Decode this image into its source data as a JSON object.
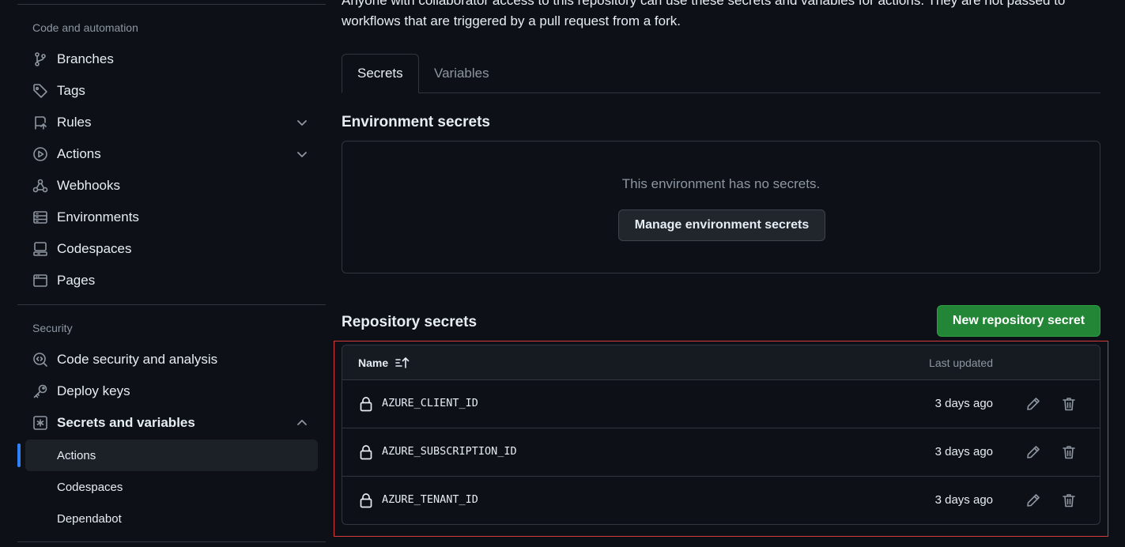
{
  "intro_text": "Anyone with collaborator access to this repository can use these secrets and variables for actions. They are not passed to workflows that are triggered by a pull request from a fork.",
  "sidebar": {
    "code_heading": "Code and automation",
    "code_items": [
      {
        "label": "Branches",
        "icon": "branch-icon"
      },
      {
        "label": "Tags",
        "icon": "tag-icon"
      },
      {
        "label": "Rules",
        "icon": "rules-icon",
        "expandable": true
      },
      {
        "label": "Actions",
        "icon": "play-icon",
        "expandable": true
      },
      {
        "label": "Webhooks",
        "icon": "webhook-icon"
      },
      {
        "label": "Environments",
        "icon": "server-icon"
      },
      {
        "label": "Codespaces",
        "icon": "codespaces-icon"
      },
      {
        "label": "Pages",
        "icon": "browser-icon"
      }
    ],
    "security_heading": "Security",
    "security_items": [
      {
        "label": "Code security and analysis",
        "icon": "codescan-icon"
      },
      {
        "label": "Deploy keys",
        "icon": "key-icon"
      },
      {
        "label": "Secrets and variables",
        "icon": "asterisk-icon",
        "expanded": true
      }
    ],
    "sub_items": [
      {
        "label": "Actions",
        "active": true
      },
      {
        "label": "Codespaces"
      },
      {
        "label": "Dependabot"
      }
    ]
  },
  "tabs": [
    {
      "label": "Secrets",
      "active": true
    },
    {
      "label": "Variables"
    }
  ],
  "environment": {
    "heading": "Environment secrets",
    "empty_text": "This environment has no secrets.",
    "manage_button": "Manage environment secrets"
  },
  "repository": {
    "heading": "Repository secrets",
    "new_button": "New repository secret",
    "col_name": "Name",
    "col_updated": "Last updated",
    "secrets": [
      {
        "name": "AZURE_CLIENT_ID",
        "updated": "3 days ago"
      },
      {
        "name": "AZURE_SUBSCRIPTION_ID",
        "updated": "3 days ago"
      },
      {
        "name": "AZURE_TENANT_ID",
        "updated": "3 days ago"
      }
    ]
  },
  "colors": {
    "background": "#0d1117",
    "accent_green": "#238636",
    "active_marker": "#2f81f7",
    "highlight_border": "#d73a3a"
  }
}
